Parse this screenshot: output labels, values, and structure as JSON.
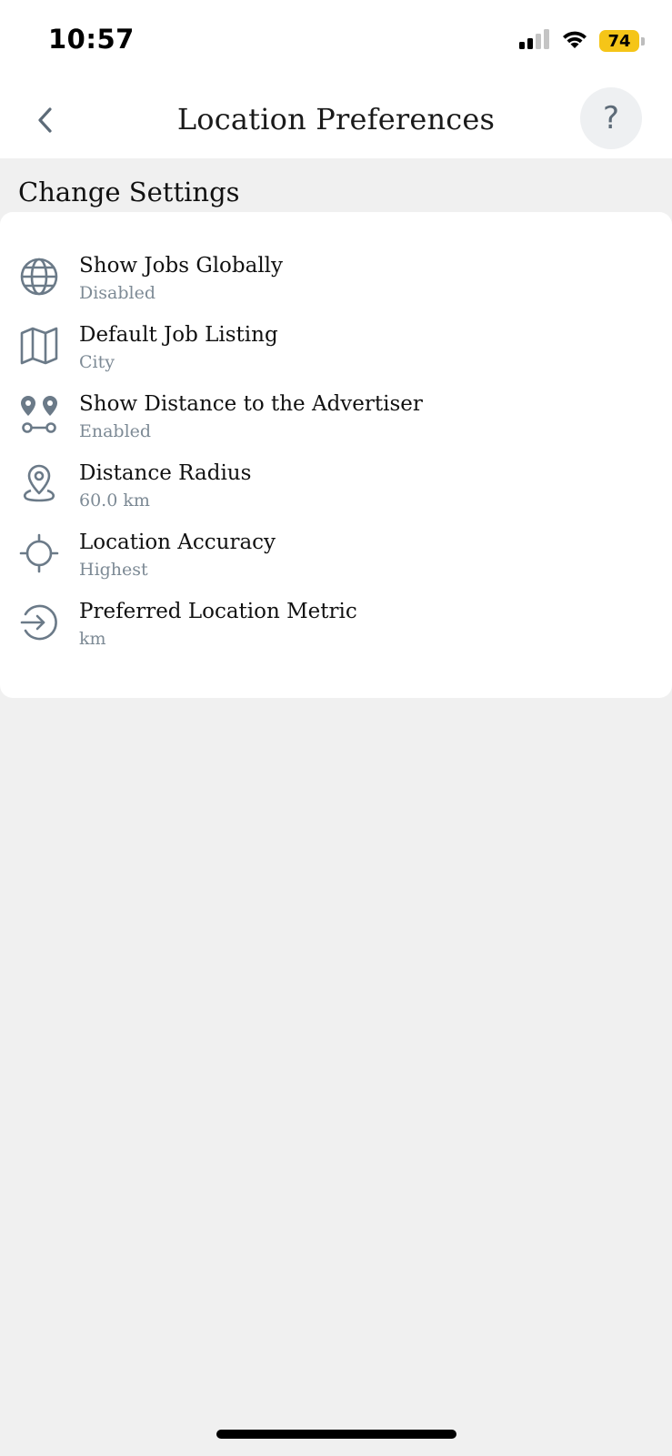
{
  "status_bar": {
    "time": "10:57",
    "battery_percent": "74",
    "cellular_icon": "cellular-signal-icon",
    "wifi_icon": "wifi-icon",
    "battery_color": "#f5c518"
  },
  "header": {
    "title": "Location Preferences",
    "back_icon": "chevron-left-icon",
    "help_label": "?"
  },
  "section": {
    "heading": "Change Settings"
  },
  "settings": [
    {
      "icon": "globe-icon",
      "title": "Show Jobs Globally",
      "value": "Disabled"
    },
    {
      "icon": "map-icon",
      "title": "Default Job Listing",
      "value": "City"
    },
    {
      "icon": "route-pins-icon",
      "title": "Show Distance to the Advertiser",
      "value": "Enabled"
    },
    {
      "icon": "location-pin-icon",
      "title": "Distance Radius",
      "value": "60.0 km"
    },
    {
      "icon": "crosshair-icon",
      "title": "Location Accuracy",
      "value": "Highest"
    },
    {
      "icon": "arrow-circle-right-icon",
      "title": "Preferred Location Metric",
      "value": "km"
    }
  ],
  "colors": {
    "icon_gray": "#6b7a88",
    "subtitle_gray": "#7d8a95",
    "background": "#f0f0f0",
    "card": "#ffffff"
  }
}
